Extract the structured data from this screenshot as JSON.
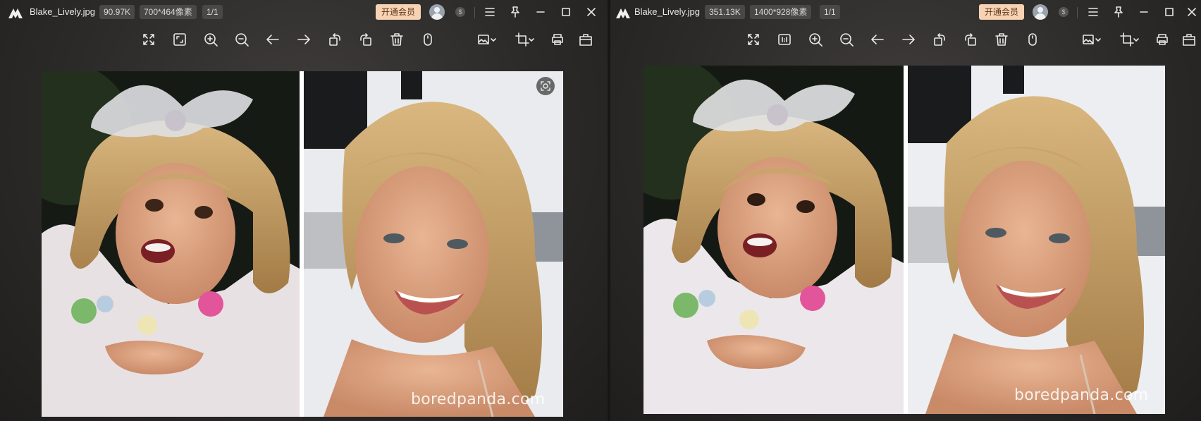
{
  "left": {
    "filename": "Blake_Lively.jpg",
    "filesize": "90.97K",
    "dimensions": "700*464像素",
    "page": "1/1",
    "vip_label": "开通会员",
    "watermark": "boredpanda.com"
  },
  "right": {
    "filename": "Blake_Lively.jpg",
    "filesize": "351.13K",
    "dimensions": "1400*928像素",
    "page": "1/1",
    "vip_label": "开通会员",
    "watermark": "boredpanda.com"
  },
  "toolbar_icons": [
    "fullscreen-icon",
    "fit-icon",
    "zoom-in-icon",
    "zoom-out-icon",
    "arrow-left-icon",
    "arrow-right-icon",
    "rotate-left-icon",
    "rotate-right-icon",
    "delete-icon",
    "mouse-icon",
    "image-edit-icon",
    "crop-icon",
    "print-icon",
    "open-icon"
  ],
  "titlebar_icons": [
    "menu-icon",
    "pin-icon",
    "minimize-icon",
    "maximize-icon",
    "close-icon"
  ],
  "colors": {
    "vip_bg": "#f7d3b4",
    "badge_bg": "#4a4847",
    "background": "#2b2a29"
  }
}
